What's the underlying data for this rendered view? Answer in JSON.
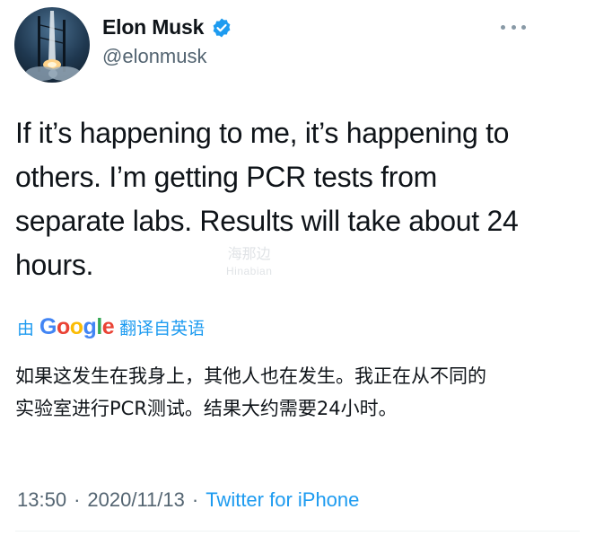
{
  "author": {
    "display_name": "Elon Musk",
    "handle": "@elonmusk",
    "verified": true,
    "avatar_icon": "rocket-launch-avatar"
  },
  "tweet": {
    "text": "If it’s happening to me, it’s happening to others. I’m getting PCR tests from separate labs. Results will take about 24 hours."
  },
  "watermark": {
    "text": "海那边",
    "subtext": "Hinabian"
  },
  "translation": {
    "prefix": "由",
    "brand_letters": [
      "G",
      "o",
      "o",
      "g",
      "l",
      "e"
    ],
    "suffix": "翻译自英语",
    "text": "如果这发生在我身上，其他人也在发生。我正在从不同的实验室进行PCR测试。结果大约需要24小时。"
  },
  "meta": {
    "time": "13:50",
    "separator": "·",
    "date": "2020/11/13",
    "source": "Twitter for iPhone"
  },
  "colors": {
    "link": "#1d9bf0",
    "text": "#0f1419",
    "muted": "#536471"
  }
}
